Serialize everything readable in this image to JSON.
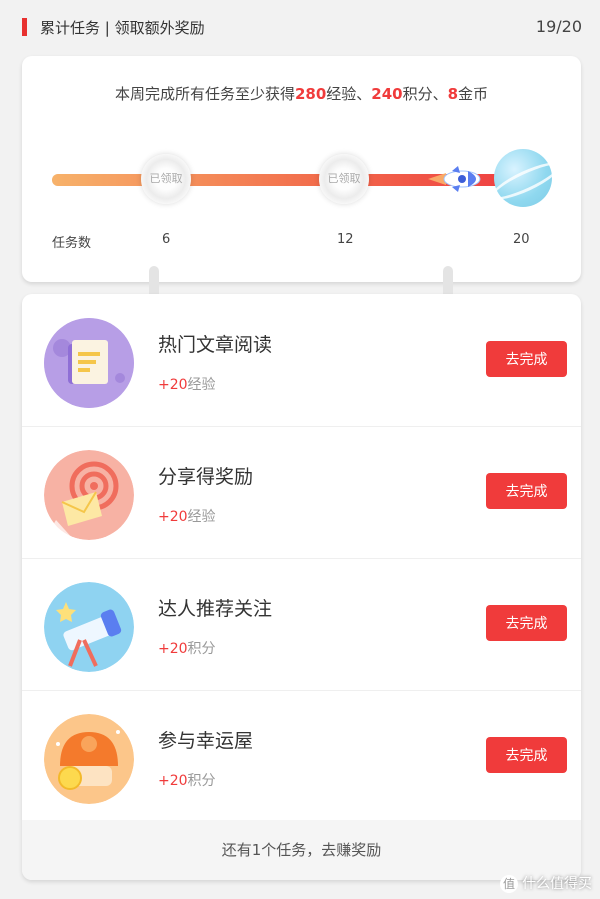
{
  "header": {
    "title": "累计任务 | 领取额外奖励",
    "count": "19/20"
  },
  "progress": {
    "summary_prefix": "本周完成所有任务至少获得",
    "exp_value": "280",
    "exp_unit": "经验、",
    "points_value": "240",
    "points_unit": "积分、",
    "coins_value": "8",
    "coins_unit": "金币",
    "claimed_label": "已领取",
    "axis_label": "任务数",
    "milestones": [
      "6",
      "12",
      "20"
    ],
    "completed_tasks": 19,
    "total_tasks": 20
  },
  "tasks": [
    {
      "name": "热门文章阅读",
      "reward_value": "+20",
      "reward_unit": "经验",
      "button": "去完成",
      "icon": "article-reading-icon"
    },
    {
      "name": "分享得奖励",
      "reward_value": "+20",
      "reward_unit": "经验",
      "button": "去完成",
      "icon": "share-icon"
    },
    {
      "name": "达人推荐关注",
      "reward_value": "+20",
      "reward_unit": "积分",
      "button": "去完成",
      "icon": "telescope-icon"
    },
    {
      "name": "参与幸运屋",
      "reward_value": "+20",
      "reward_unit": "积分",
      "button": "去完成",
      "icon": "lucky-house-icon"
    }
  ],
  "footer": {
    "text": "还有1个任务，去赚奖励"
  },
  "watermark": {
    "text": "什么值得买"
  },
  "colors": {
    "accent": "#f03b3b",
    "background": "#f2f2f2"
  }
}
